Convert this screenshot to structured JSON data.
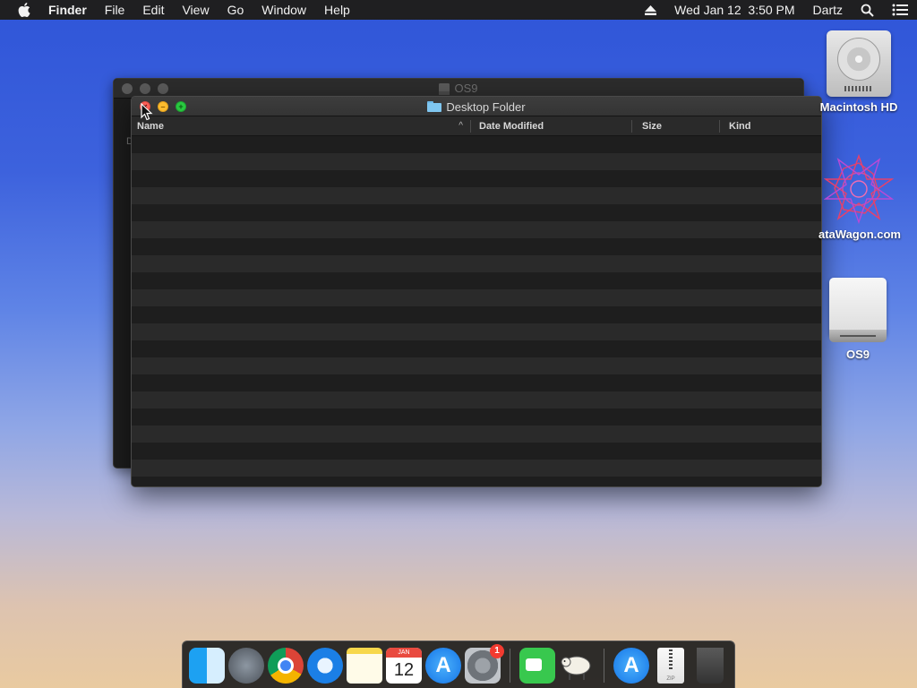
{
  "menubar": {
    "app_name": "Finder",
    "items": [
      "File",
      "Edit",
      "View",
      "Go",
      "Window",
      "Help"
    ],
    "clock": "Wed Jan 12  3:50 PM",
    "user": "Dartz"
  },
  "back_window": {
    "title": "OS9",
    "crumb": "D"
  },
  "front_window": {
    "title": "Desktop Folder",
    "columns": {
      "name": "Name",
      "date": "Date Modified",
      "size": "Size",
      "kind": "Kind"
    },
    "sort_indicator": "^"
  },
  "desktop_icons": {
    "hd": "Macintosh HD",
    "datawagon": "ataWagon.com",
    "os9": "OS9"
  },
  "dock": {
    "calendar_month": "JAN",
    "calendar_day": "12",
    "prefs_badge": "1",
    "zip_label": "ZIP"
  },
  "colors": {
    "close": "#fc5f57",
    "minimize": "#fdbc2e",
    "zoom": "#29c940",
    "menubar": "#1f1f21"
  },
  "icons": [
    "apple-logo-icon",
    "eject-icon",
    "search-icon",
    "control-center-icon",
    "folder-icon",
    "hard-drive-icon",
    "external-drive-icon",
    "finder-icon",
    "launchpad-icon",
    "chrome-icon",
    "safari-icon",
    "notes-icon",
    "calendar-icon",
    "app-store-icon",
    "system-preferences-icon",
    "facetime-icon",
    "sheep-app-icon",
    "zip-file-icon",
    "trash-icon"
  ]
}
